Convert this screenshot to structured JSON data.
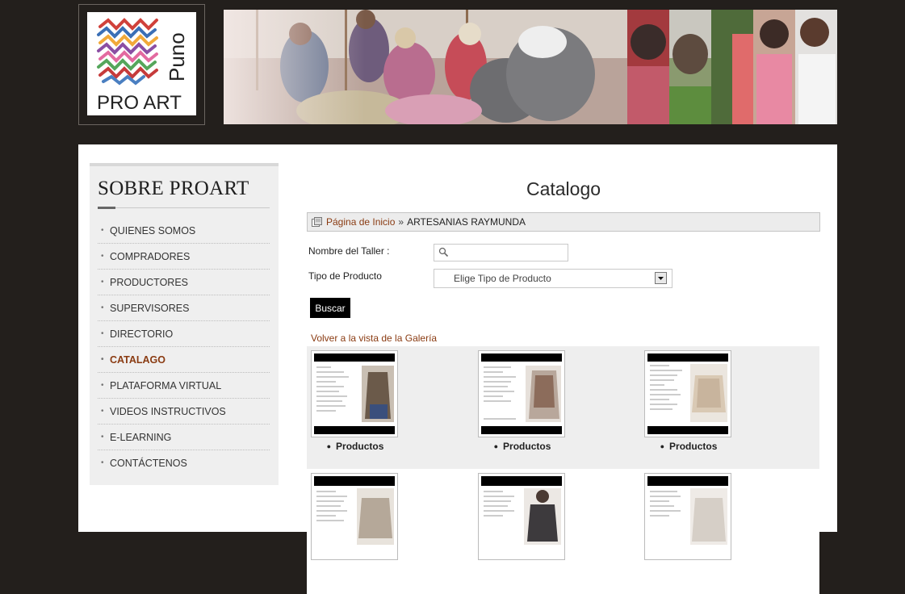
{
  "header": {
    "logo_text_line1": "PRO ART",
    "logo_text_line2": "Puno"
  },
  "sidebar": {
    "title": "SOBRE PROART",
    "items": [
      {
        "label": "QUIENES SOMOS",
        "active": false
      },
      {
        "label": "COMPRADORES",
        "active": false
      },
      {
        "label": "PRODUCTORES",
        "active": false
      },
      {
        "label": "SUPERVISORES",
        "active": false
      },
      {
        "label": "DIRECTORIO",
        "active": false
      },
      {
        "label": "CATALAGO",
        "active": true
      },
      {
        "label": "PLATAFORMA VIRTUAL",
        "active": false
      },
      {
        "label": "VIDEOS INSTRUCTIVOS",
        "active": false
      },
      {
        "label": "E-LEARNING",
        "active": false
      },
      {
        "label": "CONTÁCTENOS",
        "active": false
      }
    ]
  },
  "content": {
    "title": "Catalogo",
    "breadcrumb": {
      "home": "Página de Inicio",
      "separator": "»",
      "current": "ARTESANIAS RAYMUNDA"
    },
    "form": {
      "taller_label": "Nombre del Taller :",
      "taller_value": "",
      "tipo_label": "Tipo de Producto",
      "tipo_selected": "Elige Tipo de Producto",
      "submit_label": "Buscar"
    },
    "back_link": "Volver a la vista de la Galería",
    "gallery": {
      "row1": [
        {
          "label": "Productos"
        },
        {
          "label": "Productos"
        },
        {
          "label": "Productos"
        }
      ]
    }
  },
  "colors": {
    "page_background": "#231f1c",
    "accent_link": "#8a3b12",
    "panel": "#ffffff"
  }
}
